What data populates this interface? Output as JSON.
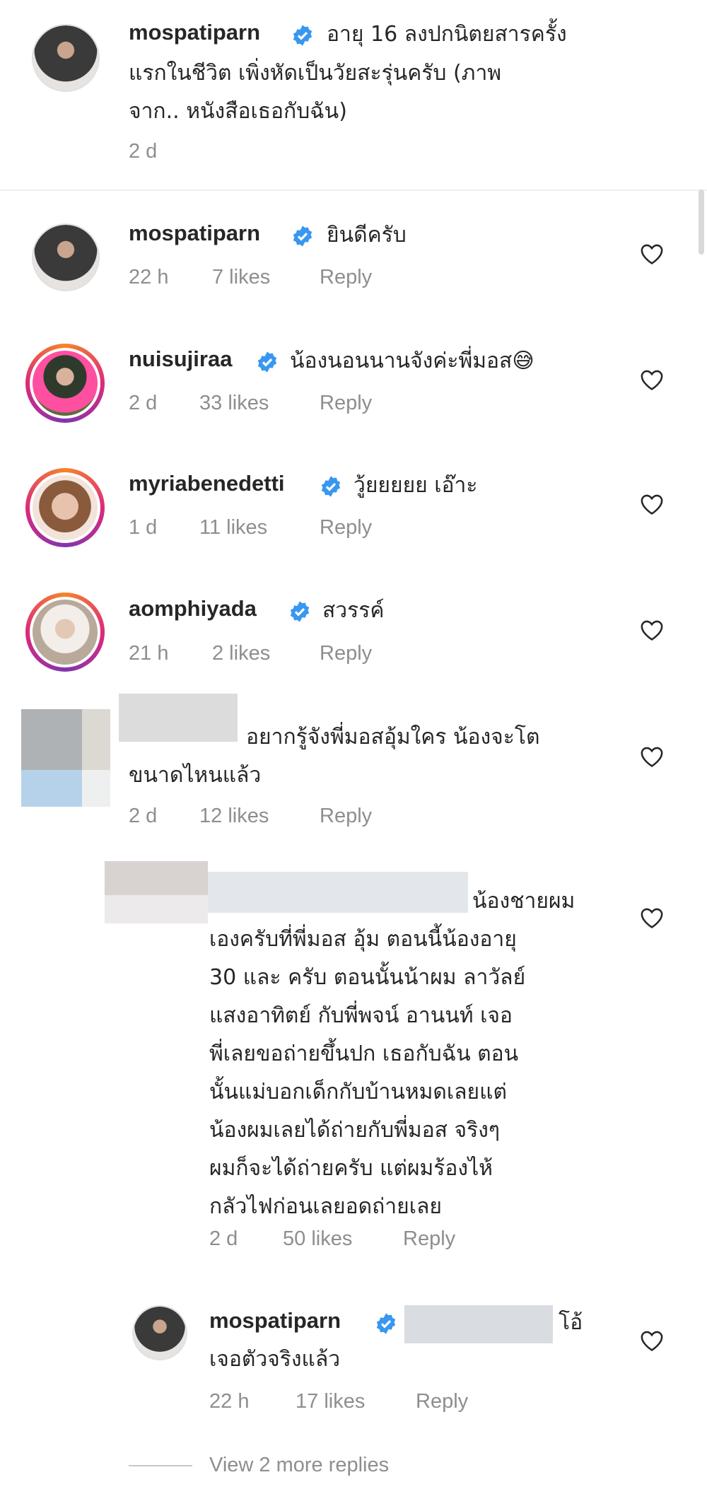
{
  "caption": {
    "username": "mospatiparn",
    "text": "อายุ 16 ลงปกนิตยสารครั้งแรกในชีวิต เพิ่งหัดเป็นวัยสะรุ่นครับ (ภาพจาก.. หนังสือเธอกับฉัน)",
    "time": "2 d"
  },
  "comments": [
    {
      "username": "mospatiparn",
      "text": "ยินดีครับ",
      "time": "22 h",
      "likes": "7 likes",
      "reply": "Reply"
    },
    {
      "username": "nuisujiraa",
      "text": "น้องนอนนานจังค่ะพี่มอส😅",
      "time": "2 d",
      "likes": "33 likes",
      "reply": "Reply"
    },
    {
      "username": "myriabenedetti",
      "text": "วู้ยยยยย เอ๊าะ",
      "time": "1 d",
      "likes": "11 likes",
      "reply": "Reply"
    },
    {
      "username": "aomphiyada",
      "text": "สวรรค์",
      "time": "21 h",
      "likes": "2 likes",
      "reply": "Reply"
    },
    {
      "username": "",
      "text": "อยากรู้จังพี่มอสอุ้มใคร น้องจะโตขนาดไหนแล้ว",
      "time": "2 d",
      "likes": "12 likes",
      "reply": "Reply"
    }
  ],
  "replies": [
    {
      "username": "",
      "text": "น้องชายผมเองครับที่พี่มอส อุ้ม ตอนนี้น้องอายุ 30 และ ครับ ตอนนั้นน้าผม ลาวัลย์ แสงอาทิตย์ กับพี่พจน์ อานนท์ เจอพี่เลยขอถ่ายขึ้นปก เธอกับฉัน ตอนนั้นแม่บอกเด็กกับบ้านหมดเลยแต่น้องผมเลยได้ถ่ายกับพี่มอส จริงๆ ผมก็จะได้ถ่ายครับ แต่ผมร้องไห้กลัวไฟก่อนเลยอดถ่ายเลย",
      "time": "2 d",
      "likes": "50 likes",
      "reply": "Reply"
    },
    {
      "username": "mospatiparn",
      "text": "โอ้เจอตัวจริงแล้ว",
      "time": "22 h",
      "likes": "17 likes",
      "reply": "Reply"
    }
  ],
  "view_more": "View 2 more replies",
  "lines": {
    "caption_l1a": "อายุ 16 ลงปกนิตยสารครั้ง",
    "caption_l2": "แรกในชีวิต  เพิ่งหัดเป็นวัยสะรุ่นครับ (ภาพ",
    "caption_l3": "จาก.. หนังสือเธอกับฉัน)",
    "c5_l1": "อยากรู้จังพี่มอสอุ้มใคร น้องจะโต",
    "c5_l2": "ขนาดไหนแล้ว",
    "r1_l1": "น้องชายผม",
    "r1_l2": "เองครับที่พี่มอส อุ้ม ตอนนี้น้องอายุ",
    "r1_l3": "30 และ ครับ ตอนนั้นน้าผม ลาวัลย์",
    "r1_l4": "แสงอาทิตย์ กับพี่พจน์ อานนท์ เจอ",
    "r1_l5": "พี่เลยขอถ่ายขึ้นปก เธอกับฉัน ตอน",
    "r1_l6": "นั้นแม่บอกเด็กกับบ้านหมดเลยแต่",
    "r1_l7": "น้องผมเลยได้ถ่ายกับพี่มอส จริงๆ",
    "r1_l8": "ผมก็จะได้ถ่ายครับ แต่ผมร้องไห้",
    "r1_l9": "กลัวไฟก่อนเลยอดถ่ายเลย",
    "r2_l1": "โอ้",
    "r2_l2": "เจอตัวจริงแล้ว"
  },
  "colors": {
    "verified": "#3897f0",
    "meta": "#8e8e8e",
    "text": "#262626"
  },
  "icons": {
    "verified": "verified-badge-icon",
    "like": "heart-outline-icon"
  }
}
